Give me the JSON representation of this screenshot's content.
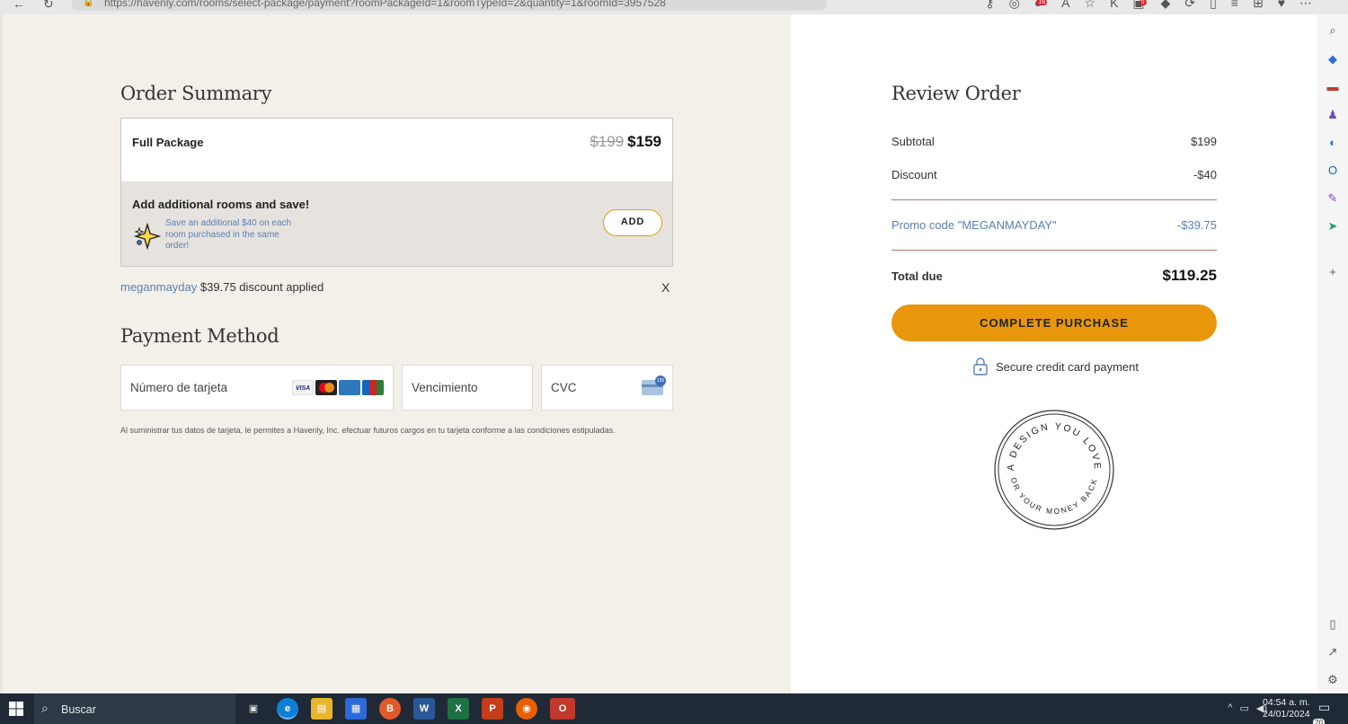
{
  "browser": {
    "url": "https://havenly.com/rooms/select-package/payment?roomPackageId=1&roomTypeId=2&quantity=1&roomId=3957528",
    "badges": [
      "16",
      "5"
    ]
  },
  "order_summary": {
    "title": "Order Summary",
    "package": {
      "name": "Full Package",
      "old_price": "$199",
      "new_price": "$159"
    },
    "addon": {
      "title": "Add additional rooms and save!",
      "description": "Save an additional $40 on each room purchased in the same order!",
      "button_label": "ADD"
    },
    "promo": {
      "code": "meganmayday",
      "text": "$39.75 discount applied",
      "remove_label": "X"
    }
  },
  "payment_method": {
    "title": "Payment Method",
    "card_number_placeholder": "Número de tarjeta",
    "expiry_placeholder": "Vencimiento",
    "cvc_placeholder": "CVC",
    "card_brands": [
      "VISA",
      "MC",
      "AMEX",
      "JCB"
    ],
    "cvc_hint": "135",
    "disclaimer": "Al suministrar tus datos de tarjeta, le permites a Havenly, Inc. efectuar futuros cargos en tu tarjeta conforme a las condiciones estipuladas."
  },
  "review_order": {
    "title": "Review Order",
    "subtotal_label": "Subtotal",
    "subtotal_value": "$199",
    "discount_label": "Discount",
    "discount_value": "-$40",
    "promo_label": "Promo code \"MEGANMAYDAY\"",
    "promo_value": "-$39.75",
    "total_label": "Total due",
    "total_value": "$119.25",
    "cta_label": "COMPLETE PURCHASE",
    "secure_label": "Secure credit card payment",
    "seal_top": "A DESIGN YOU LOVE",
    "seal_bottom": "OR YOUR MONEY BACK"
  },
  "taskbar": {
    "search_placeholder": "Buscar",
    "time": "04:54 a. m.",
    "date": "24/01/2024",
    "notifications": "20"
  },
  "colors": {
    "accent": "#e8960c",
    "link_blue": "#5a7fae",
    "left_bg": "#f3f0ea",
    "divider": "#b0796d"
  }
}
